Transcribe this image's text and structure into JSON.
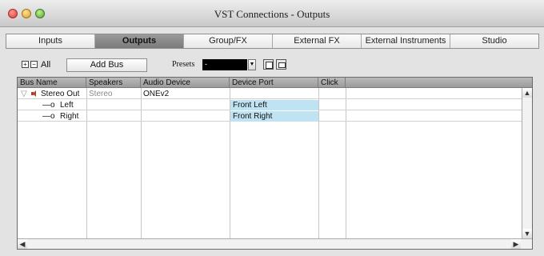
{
  "window": {
    "title": "VST Connections - Outputs"
  },
  "tabs": [
    {
      "label": "Inputs",
      "active": false
    },
    {
      "label": "Outputs",
      "active": true
    },
    {
      "label": "Group/FX",
      "active": false
    },
    {
      "label": "External FX",
      "active": false
    },
    {
      "label": "External Instruments",
      "active": false
    },
    {
      "label": "Studio",
      "active": false
    }
  ],
  "toolbar": {
    "expand_icon": "expand-all-icon",
    "collapse_icon": "collapse-all-icon",
    "all_label": "All",
    "add_bus_label": "Add Bus",
    "presets_label": "Presets",
    "presets_value": "-"
  },
  "table": {
    "columns": [
      "Bus Name",
      "Speakers",
      "Audio Device",
      "Device Port",
      "Click"
    ],
    "rows": [
      {
        "expander": "▽",
        "icon": "speaker-icon",
        "bus_name": "Stereo Out",
        "speakers": "Stereo",
        "audio_device": "ONEv2",
        "device_port": "",
        "click": ""
      },
      {
        "expander": "—o",
        "bus_name": "Left",
        "speakers": "",
        "audio_device": "",
        "device_port": "Front Left",
        "click": ""
      },
      {
        "expander": "—o",
        "bus_name": "Right",
        "speakers": "",
        "audio_device": "",
        "device_port": "Front Right",
        "click": ""
      }
    ]
  },
  "colors": {
    "port_highlight": "#bfe3f3",
    "active_tab": "#8a8a8a",
    "speaker_icon": "#b04020"
  }
}
